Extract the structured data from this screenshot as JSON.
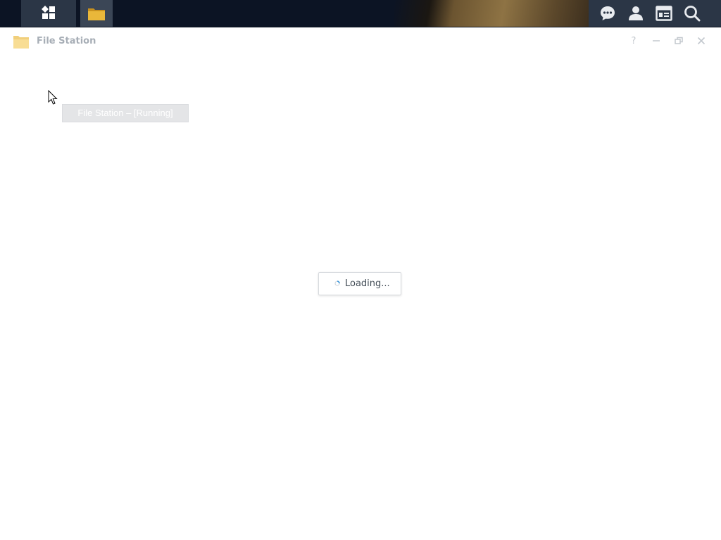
{
  "taskbar": {
    "main_menu_icon": "grid-icon",
    "open_apps": [
      {
        "name": "File Station",
        "icon": "folder-icon",
        "active": true
      }
    ],
    "right_icons": [
      "chat-icon",
      "user-icon",
      "widgets-icon",
      "search-icon"
    ]
  },
  "window": {
    "title": "File Station",
    "icon": "folder-icon",
    "controls": {
      "help": "?",
      "minimize_icon": "minimize-icon",
      "restore_icon": "restore-icon",
      "close_icon": "close-icon"
    }
  },
  "tooltip": {
    "text": "File Station – [Running]"
  },
  "loading": {
    "text": "Loading..."
  },
  "colors": {
    "taskbar_bg": "#0c1424",
    "taskbar_button": "#2b3646",
    "folder_yellow": "#e9b73a",
    "title_text": "#a7aeb6"
  }
}
